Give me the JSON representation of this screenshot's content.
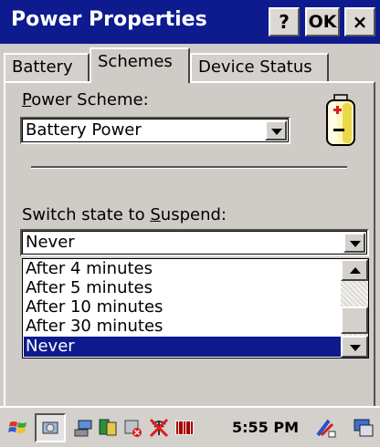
{
  "window": {
    "title": "Power Properties",
    "help_label": "?",
    "ok_label": "OK",
    "close_label": "×"
  },
  "tabs": [
    {
      "label": "Battery"
    },
    {
      "label": "Schemes",
      "active": true
    },
    {
      "label": "Device Status"
    }
  ],
  "power_scheme": {
    "label_first": "P",
    "label_rest": "ower Scheme:",
    "value": "Battery Power"
  },
  "suspend": {
    "label_prefix": "Switch state to ",
    "label_underlined": "S",
    "label_rest": "uspend:",
    "value": "Never",
    "options": [
      "After 4 minutes",
      "After 5 minutes",
      "After 10 minutes",
      "After 30 minutes",
      "Never"
    ],
    "selected_index": 4
  },
  "taskbar": {
    "clock": "5:55 PM"
  },
  "colors": {
    "title_bar": "#0e1b8f",
    "selection": "#0e1b8f",
    "face": "#d4d0cb"
  }
}
